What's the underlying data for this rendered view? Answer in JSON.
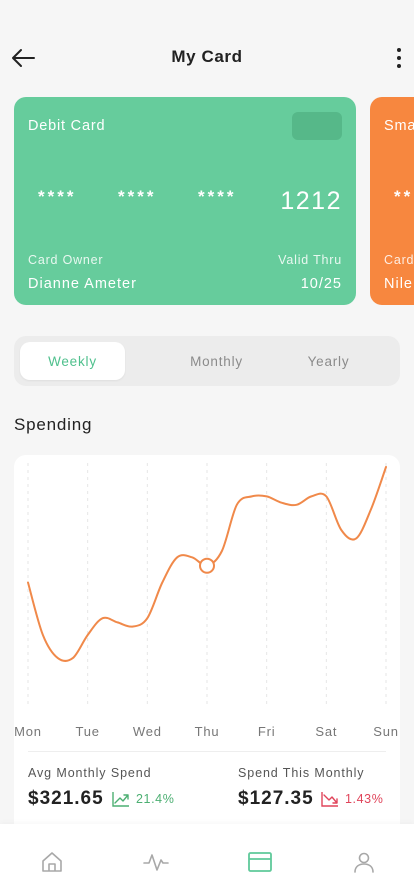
{
  "header": {
    "title": "My Card"
  },
  "cards": [
    {
      "type": "Debit Card",
      "number_groups": [
        "****",
        "****",
        "****"
      ],
      "last4": "1212",
      "owner_label": "Card Owner",
      "owner": "Dianne Ameter",
      "valid_label": "Valid Thru",
      "valid": "10/25",
      "color": "#66cc9c"
    },
    {
      "type": "Sma",
      "number_groups": [
        "**"
      ],
      "owner_label": "Card",
      "owner": "Nile",
      "color": "#f7873f"
    }
  ],
  "period": {
    "tabs": [
      "Weekly",
      "Monthly",
      "Yearly"
    ],
    "active": "Weekly"
  },
  "spending": {
    "title": "Spending",
    "chart_data": {
      "type": "line",
      "categories": [
        "Mon",
        "Tue",
        "Wed",
        "Thu",
        "Fri",
        "Sat",
        "Sun"
      ],
      "x": [
        0,
        0.25,
        0.5,
        0.75,
        1.0,
        1.25,
        1.5,
        1.75,
        2.0,
        2.25,
        2.5,
        2.75,
        3.0,
        3.25,
        3.5,
        3.75,
        4.0,
        4.25,
        4.5,
        4.75,
        5.0,
        5.25,
        5.5,
        5.75,
        6.0
      ],
      "series": [
        {
          "values": [
            45,
            20,
            9,
            9,
            20,
            28,
            26,
            24,
            28,
            45,
            57,
            57,
            53,
            60,
            82,
            86,
            86,
            83,
            82,
            86,
            86,
            70,
            66,
            80,
            100
          ]
        }
      ],
      "ylim": [
        0,
        100
      ],
      "highlight_category": "Thu",
      "grid": "vertical-dashed",
      "line_color": "#f0894a"
    },
    "stats": [
      {
        "label": "Avg Monthly Spend",
        "value": "$321.65",
        "change": "21.4%",
        "direction": "up",
        "color": "#4caf72"
      },
      {
        "label": "Spend This Monthly",
        "value": "$127.35",
        "change": "1.43%",
        "direction": "down",
        "color": "#e0445a"
      }
    ]
  },
  "nav": {
    "items": [
      {
        "icon": "home-icon"
      },
      {
        "icon": "activity-icon"
      },
      {
        "icon": "card-icon",
        "active": true
      },
      {
        "icon": "profile-icon"
      }
    ],
    "active_color": "#5fc99a",
    "inactive_color": "#a8a8a8"
  }
}
